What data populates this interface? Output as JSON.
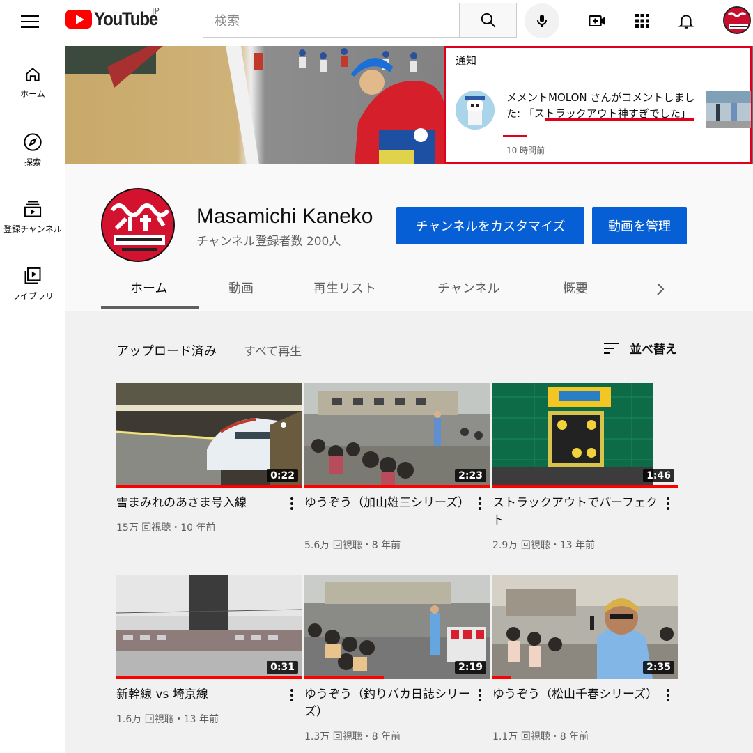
{
  "header": {
    "logo_text": "YouTube",
    "region": "JP",
    "search_placeholder": "検索"
  },
  "sidebar": {
    "items": [
      {
        "label": "ホーム",
        "icon": "home-icon"
      },
      {
        "label": "探索",
        "icon": "compass-icon"
      },
      {
        "label": "登録チャンネル",
        "icon": "subscriptions-icon"
      },
      {
        "label": "ライブラリ",
        "icon": "library-icon"
      }
    ]
  },
  "notification": {
    "title": "通知",
    "message": "メメントMOLON さんがコメントしました: 「ストラックアウト神すぎでした」",
    "time": "10 時間前"
  },
  "channel": {
    "name": "Masamichi Kaneko",
    "subscribers": "チャンネル登録者数 200人",
    "customize_label": "チャンネルをカスタマイズ",
    "manage_label": "動画を管理",
    "tabs": [
      "ホーム",
      "動画",
      "再生リスト",
      "チャンネル",
      "概要"
    ]
  },
  "uploads": {
    "title": "アップロード済み",
    "play_all": "すべて再生",
    "sort_label": "並べ替え",
    "videos": [
      {
        "title": "雪まみれのあさま号入線",
        "meta": "15万 回視聴・10 年前",
        "duration": "0:22",
        "watched": 1.0
      },
      {
        "title": "ゆうぞう（加山雄三シリーズ）",
        "meta": "5.6万 回視聴・8 年前",
        "duration": "2:23",
        "watched": 1.0
      },
      {
        "title": "ストラックアウトでパーフェクト",
        "meta": "2.9万 回視聴・13 年前",
        "duration": "1:46",
        "watched": 1.0
      },
      {
        "title": "新幹線 vs 埼京線",
        "meta": "1.6万 回視聴・13 年前",
        "duration": "0:31",
        "watched": 1.0
      },
      {
        "title": "ゆうぞう（釣りバカ日誌シリーズ）",
        "meta": "1.3万 回視聴・8 年前",
        "duration": "2:19",
        "watched": 0.43
      },
      {
        "title": "ゆうぞう（松山千春シリーズ）",
        "meta": "1.1万 回視聴・8 年前",
        "duration": "2:35",
        "watched": 0.1
      }
    ]
  }
}
